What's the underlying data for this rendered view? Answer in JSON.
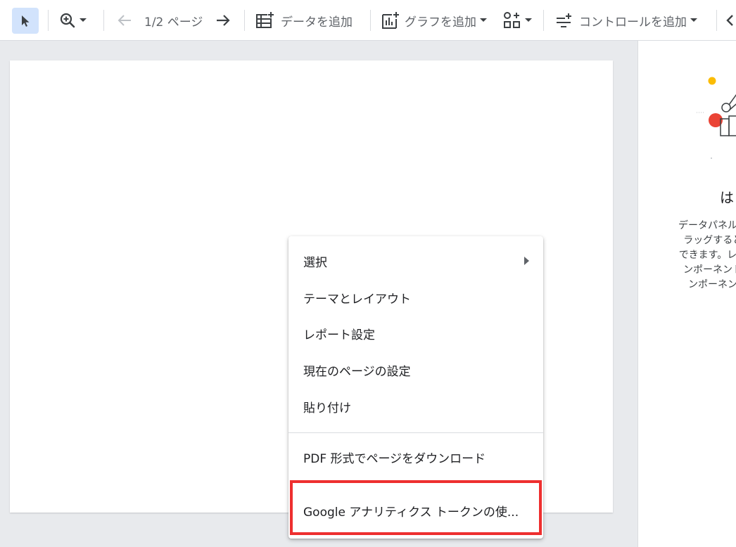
{
  "toolbar": {
    "page_nav": "1/2 ページ",
    "add_data": "データを追加",
    "add_chart": "グラフを追加",
    "add_control": "コントロールを追加"
  },
  "right_panel": {
    "title": "はじ",
    "description_lines": [
      "データパネルの項",
      "ラッグすると、",
      "できます。レポー",
      "ンポーネントを",
      "ンポーネント"
    ]
  },
  "context_menu": {
    "items": [
      {
        "label": "選択",
        "has_submenu": true
      },
      {
        "label": "テーマとレイアウト"
      },
      {
        "label": "レポート設定"
      },
      {
        "label": "現在のページの設定"
      },
      {
        "label": "貼り付け"
      },
      {
        "label": "PDF 形式でページをダウンロード"
      },
      {
        "label": "Google アナリティクス トークンの使..."
      }
    ]
  },
  "colors": {
    "accent_select": "#d2e3fc",
    "highlight": "#ee2f2f",
    "chart_yellow": "#fbbc04",
    "chart_red": "#ea4335"
  }
}
